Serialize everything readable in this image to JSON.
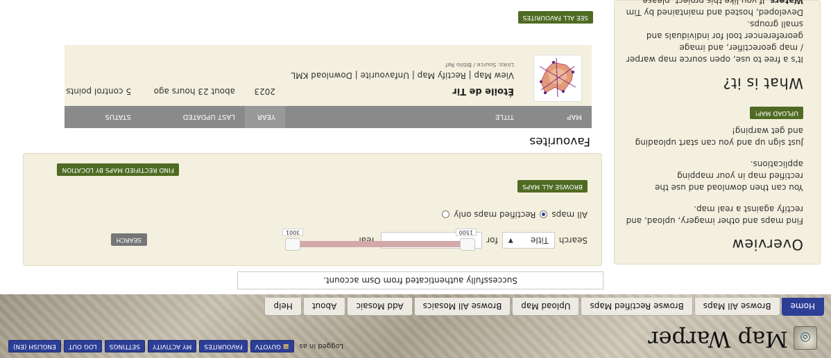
{
  "header": {
    "site_title": "Map Warper",
    "logged_in_label": "Logged in as",
    "user_buttons": [
      "GUYOTV",
      "FAVOURITES",
      "MY ACTIVITY",
      "SETTINGS",
      "LOG OUT",
      "ENGLISH (EN)"
    ],
    "user_icon": "map-icon",
    "logo_icon": "globe-icon"
  },
  "tabs": [
    "Home",
    "Browse All Maps",
    "Browse Rectified Maps",
    "Upload Map",
    "Browse All Mosaics",
    "Add Mosaic",
    "About",
    "Help"
  ],
  "notice": "Successfully authenticated from Osm account.",
  "sidebar": {
    "overview_title": "Overview",
    "overview_p1": "Find maps and other imagery, upload, and rectify against a real map.",
    "overview_p2": "You can then download and use the rectified map in your mapping applications.",
    "overview_p3": "Just sign up and you can start uploading and get warping!",
    "upload_button": "UPLOAD MAP!",
    "what_title": "What is it?",
    "what_p1": "It's a free to use, open source map warper / map georectifier, and image georeferencer tool for individuals and small groups.",
    "what_p2_prefix": "Developed, hosted and maintained by Tim",
    "what_p2_bold": "Waters",
    "what_p2_suffix": ". If you like this project, please"
  },
  "search": {
    "label": "Search",
    "field_value": "Title",
    "for_label": "for",
    "year_label": "Year",
    "year_min": "1500",
    "year_max": "3001",
    "button": "SEARCH",
    "radio_all": "All maps",
    "radio_rectified": "Rectified maps only",
    "selected_radio": "Rectified maps only",
    "browse_button": "BROWSE ALL MAPS",
    "find_location_button": "FIND RECTIFIED MAPS BY LOCATION"
  },
  "favourites": {
    "title": "Favourites",
    "headers": {
      "map": "MAP",
      "title": "TITLE",
      "year": "YEAR",
      "last_updated": "LAST UPDATED",
      "status": "STATUS"
    },
    "rows": [
      {
        "title": "Étoile de Tir",
        "links": "View Map | Rectify Map | Unfavourite | Download KML",
        "small_links": "Links: Source / Biblio Ref",
        "year": "2023",
        "last_updated": "about 23 hours ago",
        "status": "5 control points"
      }
    ],
    "see_all_button": "SEE ALL FAVOURITES"
  },
  "colors": {
    "accent_blue": "#2c3e96",
    "accent_green": "#4f6b23",
    "panel_bg": "#f4f0df",
    "slider_range": "#d2a8a8"
  }
}
